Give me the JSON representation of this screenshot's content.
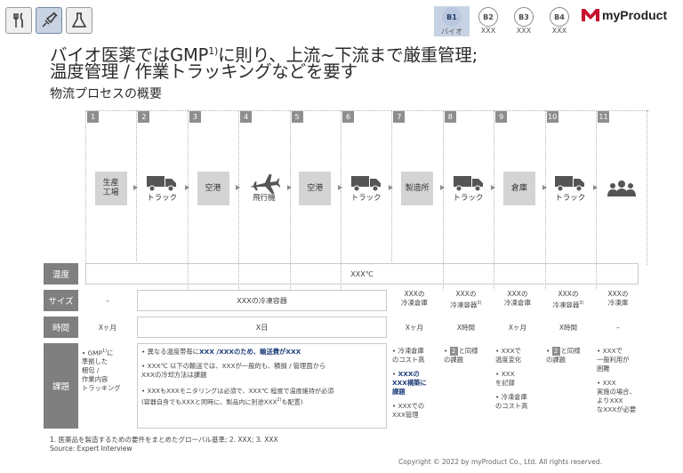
{
  "header": {
    "icons": [
      {
        "name": "cutlery-icon",
        "active": false
      },
      {
        "name": "syringe-icon",
        "active": true
      },
      {
        "name": "flask-icon",
        "active": false
      }
    ],
    "sections": [
      {
        "code": "B1",
        "label": "バイオ",
        "active": true
      },
      {
        "code": "B2",
        "label": "XXX",
        "active": false
      },
      {
        "code": "B3",
        "label": "XXX",
        "active": false
      },
      {
        "code": "B4",
        "label": "XXX",
        "active": false
      }
    ],
    "logo_text": "myProduct"
  },
  "title": {
    "line1_pre": "バイオ医薬ではGMP",
    "line1_sup": "1)",
    "line1_post": "に則り、上流~下流まで厳重管理;",
    "line2": "温度管理 / 作業トラッキングなどを要す",
    "subtitle": "物流プロセスの概要"
  },
  "steps": [
    {
      "num": "1",
      "label": "生産\n工場",
      "kind": "box"
    },
    {
      "num": "2",
      "label": "トラック",
      "kind": "truck"
    },
    {
      "num": "3",
      "label": "空港",
      "kind": "box"
    },
    {
      "num": "4",
      "label": "飛行機",
      "kind": "plane"
    },
    {
      "num": "5",
      "label": "空港",
      "kind": "box"
    },
    {
      "num": "6",
      "label": "トラック",
      "kind": "truck"
    },
    {
      "num": "7",
      "label": "製造所",
      "kind": "box"
    },
    {
      "num": "8",
      "label": "トラック",
      "kind": "truck"
    },
    {
      "num": "9",
      "label": "倉庫",
      "kind": "box"
    },
    {
      "num": "10",
      "label": "トラック",
      "kind": "truck"
    },
    {
      "num": "11",
      "label": "",
      "kind": "people"
    }
  ],
  "rows": {
    "temp": {
      "head": "温度",
      "value": "XXX℃"
    },
    "size": {
      "head": "サイズ",
      "c1": "–",
      "c2": "XXXの冷凍容器",
      "c7": "XXXの\n冷凍倉庫",
      "c8": "XXXの\n冷凍容器",
      "c8_sup": "3)",
      "c9": "XXXの\n冷凍倉庫",
      "c10": "XXXの\n冷凍容器",
      "c10_sup": "3)",
      "c11": "XXXの\n冷凍庫"
    },
    "time": {
      "head": "時間",
      "c1": "Xヶ月",
      "c2": "X日",
      "c7": "Xヶ月",
      "c8": "X時間",
      "c9": "Xヶ月",
      "c10": "X時間",
      "c11": "–"
    },
    "issue": {
      "head": "課題",
      "c1": {
        "pre": "GMP",
        "sup": "1)",
        "post": "に\n準拠した\n梱包 /\n作業内容\nトラッキング"
      },
      "c2": {
        "b1_pre": "異なる温度帯毎に",
        "b1_blue": "XXX /XXXのため、輸送費がXXX",
        "b2": "XXX℃ 以下の輸送では、XXXが一般的も、積損 / 管理面から\nXXXの冷却方法は課題",
        "b3_pre": "XXXもXXXモニタリングは必須で、XXX℃ 程度で温度維持が必須\n(容器自身でもXXXと同時に、製品内に別途XXX",
        "b3_sup": "2)",
        "b3_post": "も配置)"
      },
      "c7": {
        "b1": "冷凍倉庫\nのコスト高",
        "b2_blue": "XXXの\nXXX構築に\n課題",
        "b3": "XXXでの\nXXX管理"
      },
      "c8": {
        "chip": "2",
        "text": "と同様\nの課題"
      },
      "c9": {
        "b1": "XXXで\n温度変化",
        "b2": "XXX\nを記録",
        "b3": "冷凍倉庫\nのコスト高"
      },
      "c10": {
        "chip": "2",
        "text": "と同様\nの課題"
      },
      "c11": {
        "b1": "XXXで\n一般利用が\n困難",
        "b2": "XXX\n実施の場合、\nよりXXX\nなXXXが必要"
      }
    }
  },
  "footnote": "1. 医薬品を製造するための要件をまとめたグローバル基準;  2. XXX;  3. XXX",
  "source": "Source: Expert Interview",
  "copyright": "Copyright © 2022 by myProduct Co., Ltd.  All rights reserved."
}
